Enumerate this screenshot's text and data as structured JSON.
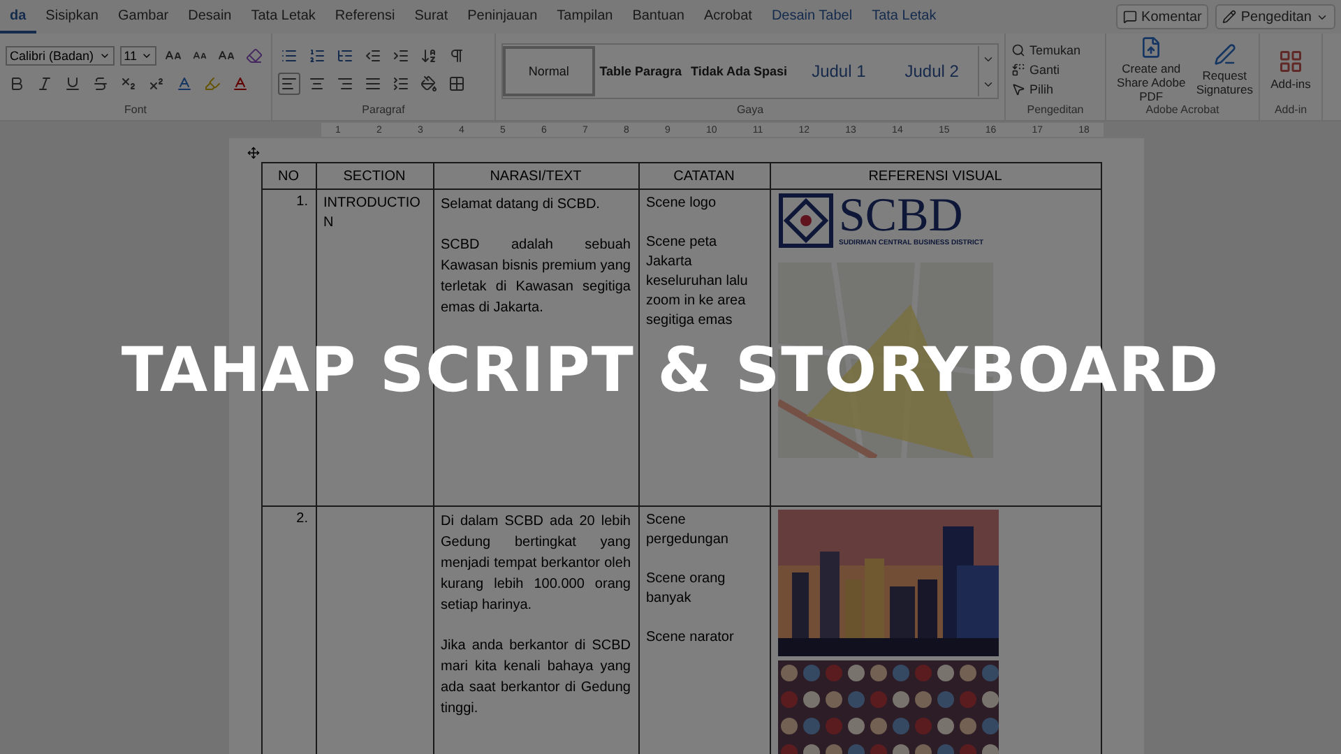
{
  "ribbon_tabs": [
    {
      "label": "da",
      "selected": true,
      "kind": "main"
    },
    {
      "label": "Sisipkan",
      "selected": false,
      "kind": "main"
    },
    {
      "label": "Gambar",
      "selected": false,
      "kind": "main"
    },
    {
      "label": "Desain",
      "selected": false,
      "kind": "main"
    },
    {
      "label": "Tata Letak",
      "selected": false,
      "kind": "main"
    },
    {
      "label": "Referensi",
      "selected": false,
      "kind": "main"
    },
    {
      "label": "Surat",
      "selected": false,
      "kind": "main"
    },
    {
      "label": "Peninjauan",
      "selected": false,
      "kind": "main"
    },
    {
      "label": "Tampilan",
      "selected": false,
      "kind": "main"
    },
    {
      "label": "Bantuan",
      "selected": false,
      "kind": "main"
    },
    {
      "label": "Acrobat",
      "selected": false,
      "kind": "main"
    },
    {
      "label": "Desain Tabel",
      "selected": false,
      "kind": "contextual"
    },
    {
      "label": "Tata Letak",
      "selected": false,
      "kind": "contextual"
    }
  ],
  "header_buttons": [
    {
      "label": "Komentar",
      "kind": "comment"
    },
    {
      "label": "Pengeditan",
      "kind": "edit"
    }
  ],
  "font_group": {
    "font": "Calibri (Badan)",
    "size": "11",
    "label": "Font"
  },
  "paragraph_group": {
    "label": "Paragraf"
  },
  "styles_group": {
    "label": "Gaya",
    "styles": [
      {
        "label": "Normal",
        "selected": true,
        "kind": "normal"
      },
      {
        "label": "Table Paragra",
        "selected": false,
        "kind": "bold"
      },
      {
        "label": "Tidak Ada Spasi",
        "selected": false,
        "kind": "bold"
      },
      {
        "label": "Judul 1",
        "selected": false,
        "kind": "heading"
      },
      {
        "label": "Judul 2",
        "selected": false,
        "kind": "heading"
      }
    ]
  },
  "editing_group": {
    "label": "Pengeditan",
    "items": [
      {
        "label": "Temukan",
        "kind": "find"
      },
      {
        "label": "Ganti",
        "kind": "replace"
      },
      {
        "label": "Pilih",
        "kind": "select"
      }
    ]
  },
  "acrobat_group": {
    "label": "Adobe Acrobat",
    "items": [
      {
        "label": "Create and Share Adobe PDF",
        "kind": "pdf"
      },
      {
        "label": "Request Signatures",
        "kind": "sign"
      }
    ]
  },
  "addin_group": {
    "label": "Add-in",
    "items": [
      {
        "label": "Add-ins"
      }
    ]
  },
  "ruler": {
    "ticks": [
      "1",
      "2",
      "3",
      "4",
      "5",
      "6",
      "7",
      "8",
      "9",
      "10",
      "11",
      "12",
      "13",
      "14",
      "15",
      "16",
      "17",
      "18"
    ]
  },
  "table": {
    "columns": [
      "NO",
      "SECTION",
      "NARASI/TEXT",
      "CATATAN",
      "REFERENSI VISUAL"
    ],
    "rows": [
      {
        "no": "1.",
        "section": "INTRODUCTION",
        "narasi": [
          "Selamat datang di SCBD.",
          "SCBD adalah sebuah Kawasan bisnis premium yang terletak di Kawasan segitiga emas di Jakarta."
        ],
        "catatan": [
          "Scene logo",
          "Scene peta Jakarta keseluruhan lalu zoom in ke area segitiga emas"
        ],
        "visuals": [
          {
            "kind": "logo",
            "title": "SCBD",
            "subtitle": "SUDIRMAN CENTRAL BUSINESS DISTRICT"
          },
          {
            "kind": "map"
          }
        ]
      },
      {
        "no": "2.",
        "section": "",
        "narasi": [
          "Di dalam SCBD ada 20 lebih Gedung bertingkat yang menjadi tempat berkantor oleh kurang lebih 100.000 orang setiap harinya.",
          "Jika anda berkantor di SCBD mari kita kenali bahaya yang ada saat berkantor di Gedung tinggi."
        ],
        "catatan": [
          "Scene pergedungan",
          "Scene orang banyak",
          "Scene narator"
        ],
        "visuals": [
          {
            "kind": "city"
          },
          {
            "kind": "crowd"
          }
        ]
      }
    ]
  },
  "overlay_title": "TAHAP SCRIPT & STORYBOARD"
}
